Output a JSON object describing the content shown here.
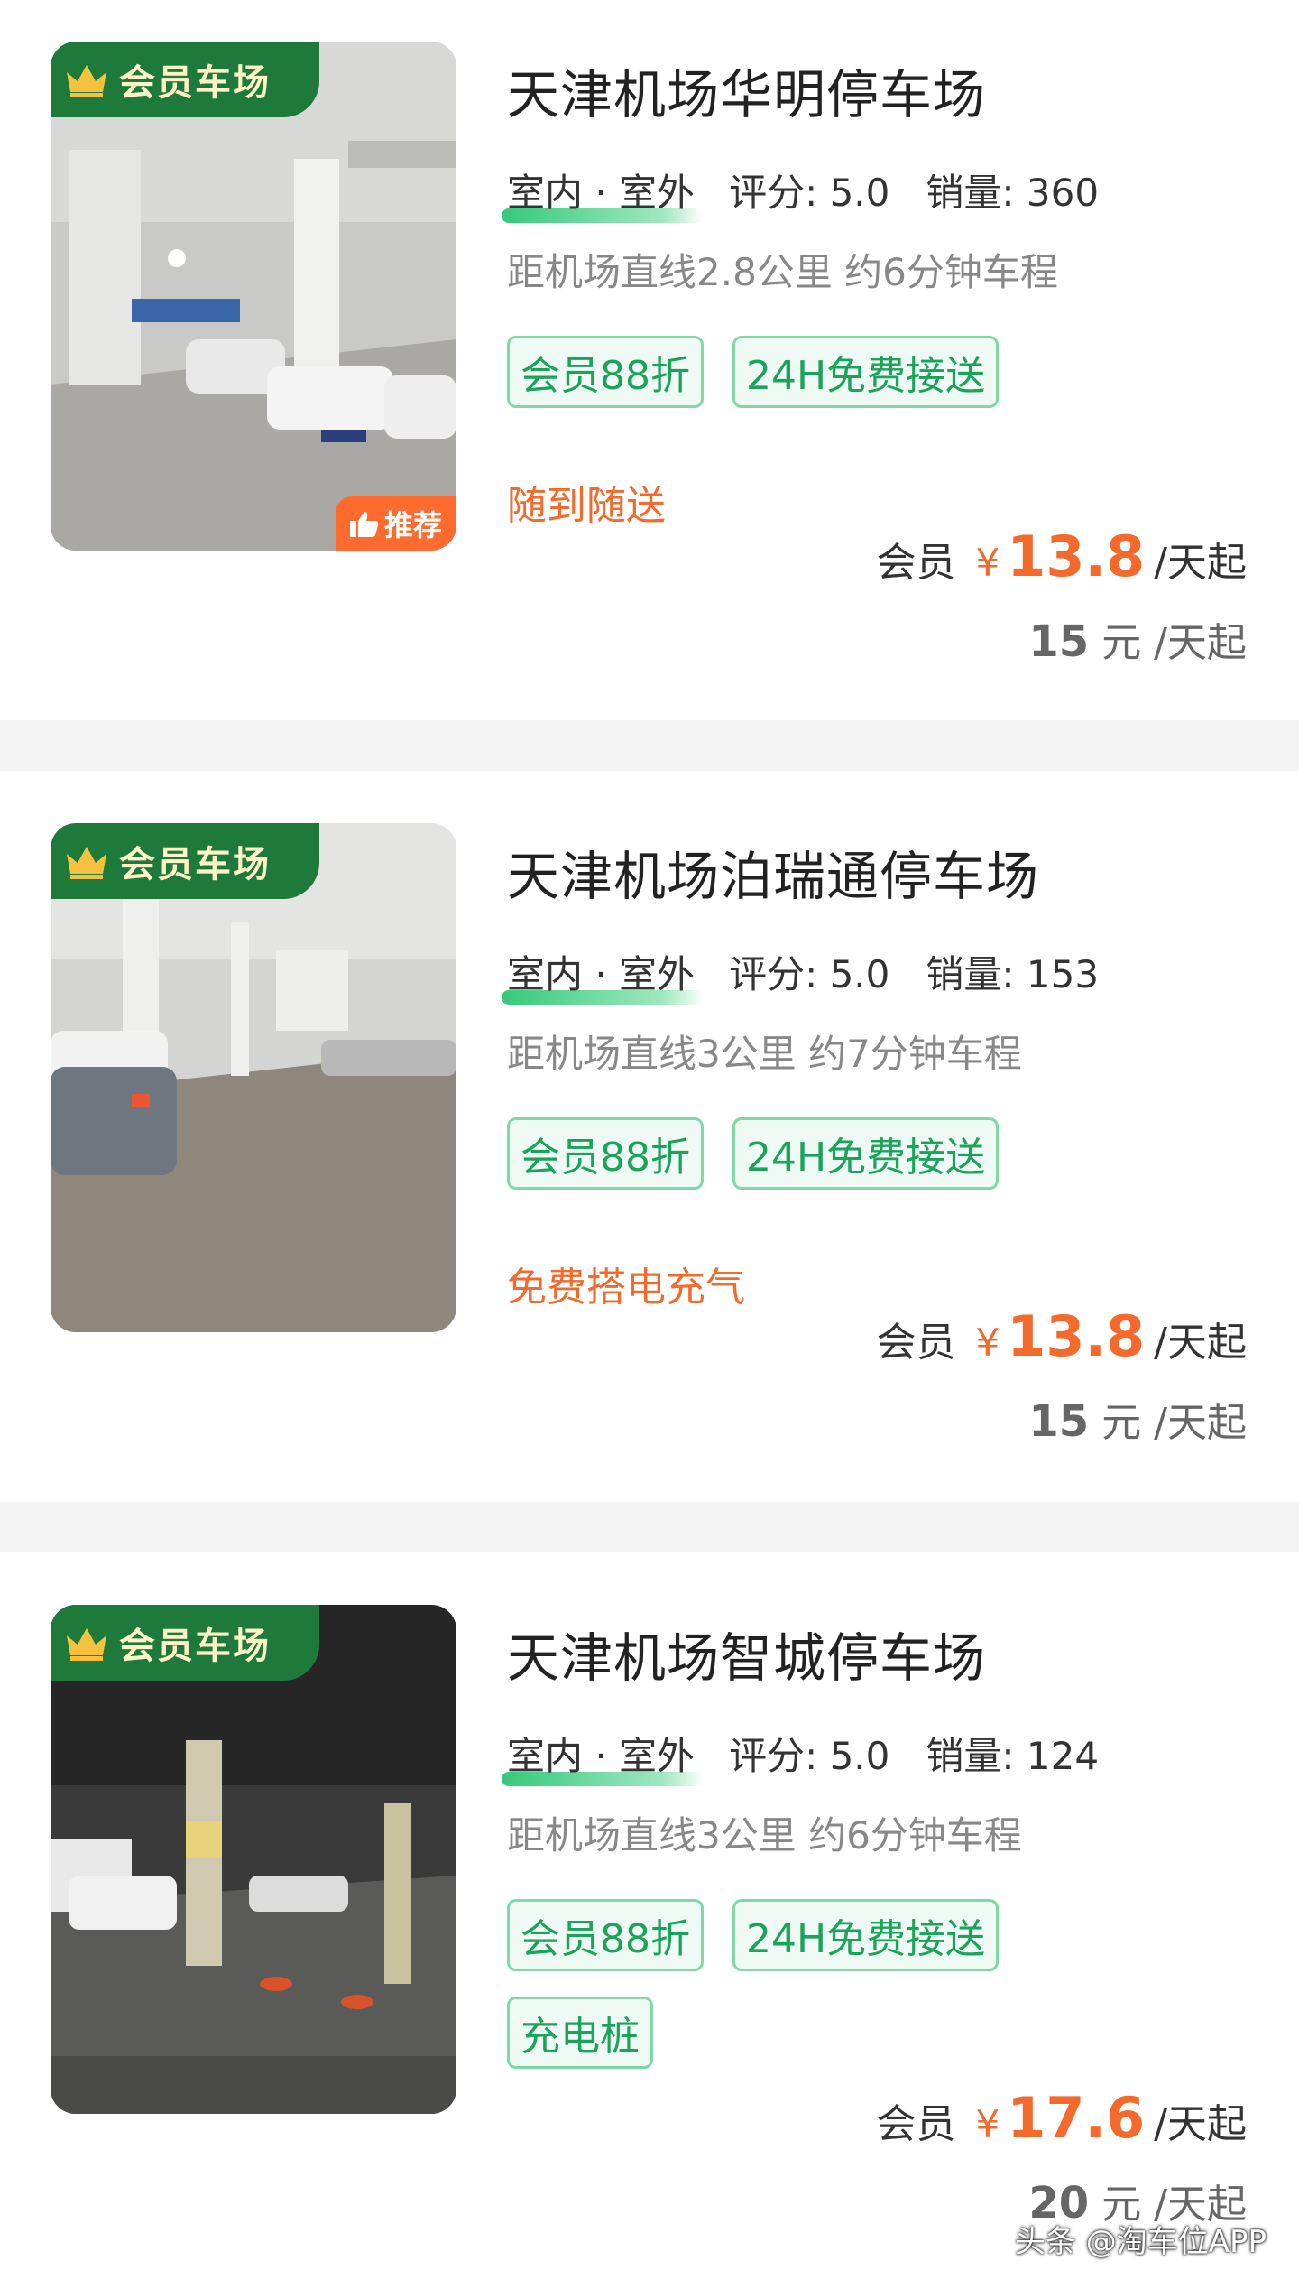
{
  "lots": [
    {
      "member_badge": "会员车场",
      "recommend_badge": "推荐",
      "name": "天津机场华明停车场",
      "type": "室内 · 室外",
      "rating_label": "评分:",
      "rating": "5.0",
      "sales_label": "销量:",
      "sales": "360",
      "distance": "距机场直线2.8公里 约6分钟车程",
      "tags": [
        "会员88折",
        "24H免费接送"
      ],
      "note": "随到随送",
      "price_label": "会员",
      "currency": "¥",
      "member_price": "13.8",
      "price_unit": "/天起",
      "original_price": "15",
      "original_unit": "元 /天起",
      "photo_icon": "indoor-parking-photo"
    },
    {
      "member_badge": "会员车场",
      "name": "天津机场泊瑞通停车场",
      "type": "室内 · 室外",
      "rating_label": "评分:",
      "rating": "5.0",
      "sales_label": "销量:",
      "sales": "153",
      "distance": "距机场直线3公里 约7分钟车程",
      "tags": [
        "会员88折",
        "24H免费接送"
      ],
      "note": "免费搭电充气",
      "price_label": "会员",
      "currency": "¥",
      "member_price": "13.8",
      "price_unit": "/天起",
      "original_price": "15",
      "original_unit": "元 /天起",
      "photo_icon": "indoor-parking-photo"
    },
    {
      "member_badge": "会员车场",
      "name": "天津机场智城停车场",
      "type": "室内 · 室外",
      "rating_label": "评分:",
      "rating": "5.0",
      "sales_label": "销量:",
      "sales": "124",
      "distance": "距机场直线3公里 约6分钟车程",
      "tags": [
        "会员88折",
        "24H免费接送",
        "充电桩"
      ],
      "note": "",
      "price_label": "会员",
      "currency": "¥",
      "member_price": "17.6",
      "price_unit": "/天起",
      "original_price": "20",
      "original_unit": "元 /天起",
      "photo_icon": "indoor-parking-photo"
    }
  ],
  "watermark": "头条 @淘车位APP",
  "colors": {
    "accent_orange": "#f46a2c",
    "tag_green": "#1aa35b",
    "badge_green": "#1e7a3a"
  }
}
